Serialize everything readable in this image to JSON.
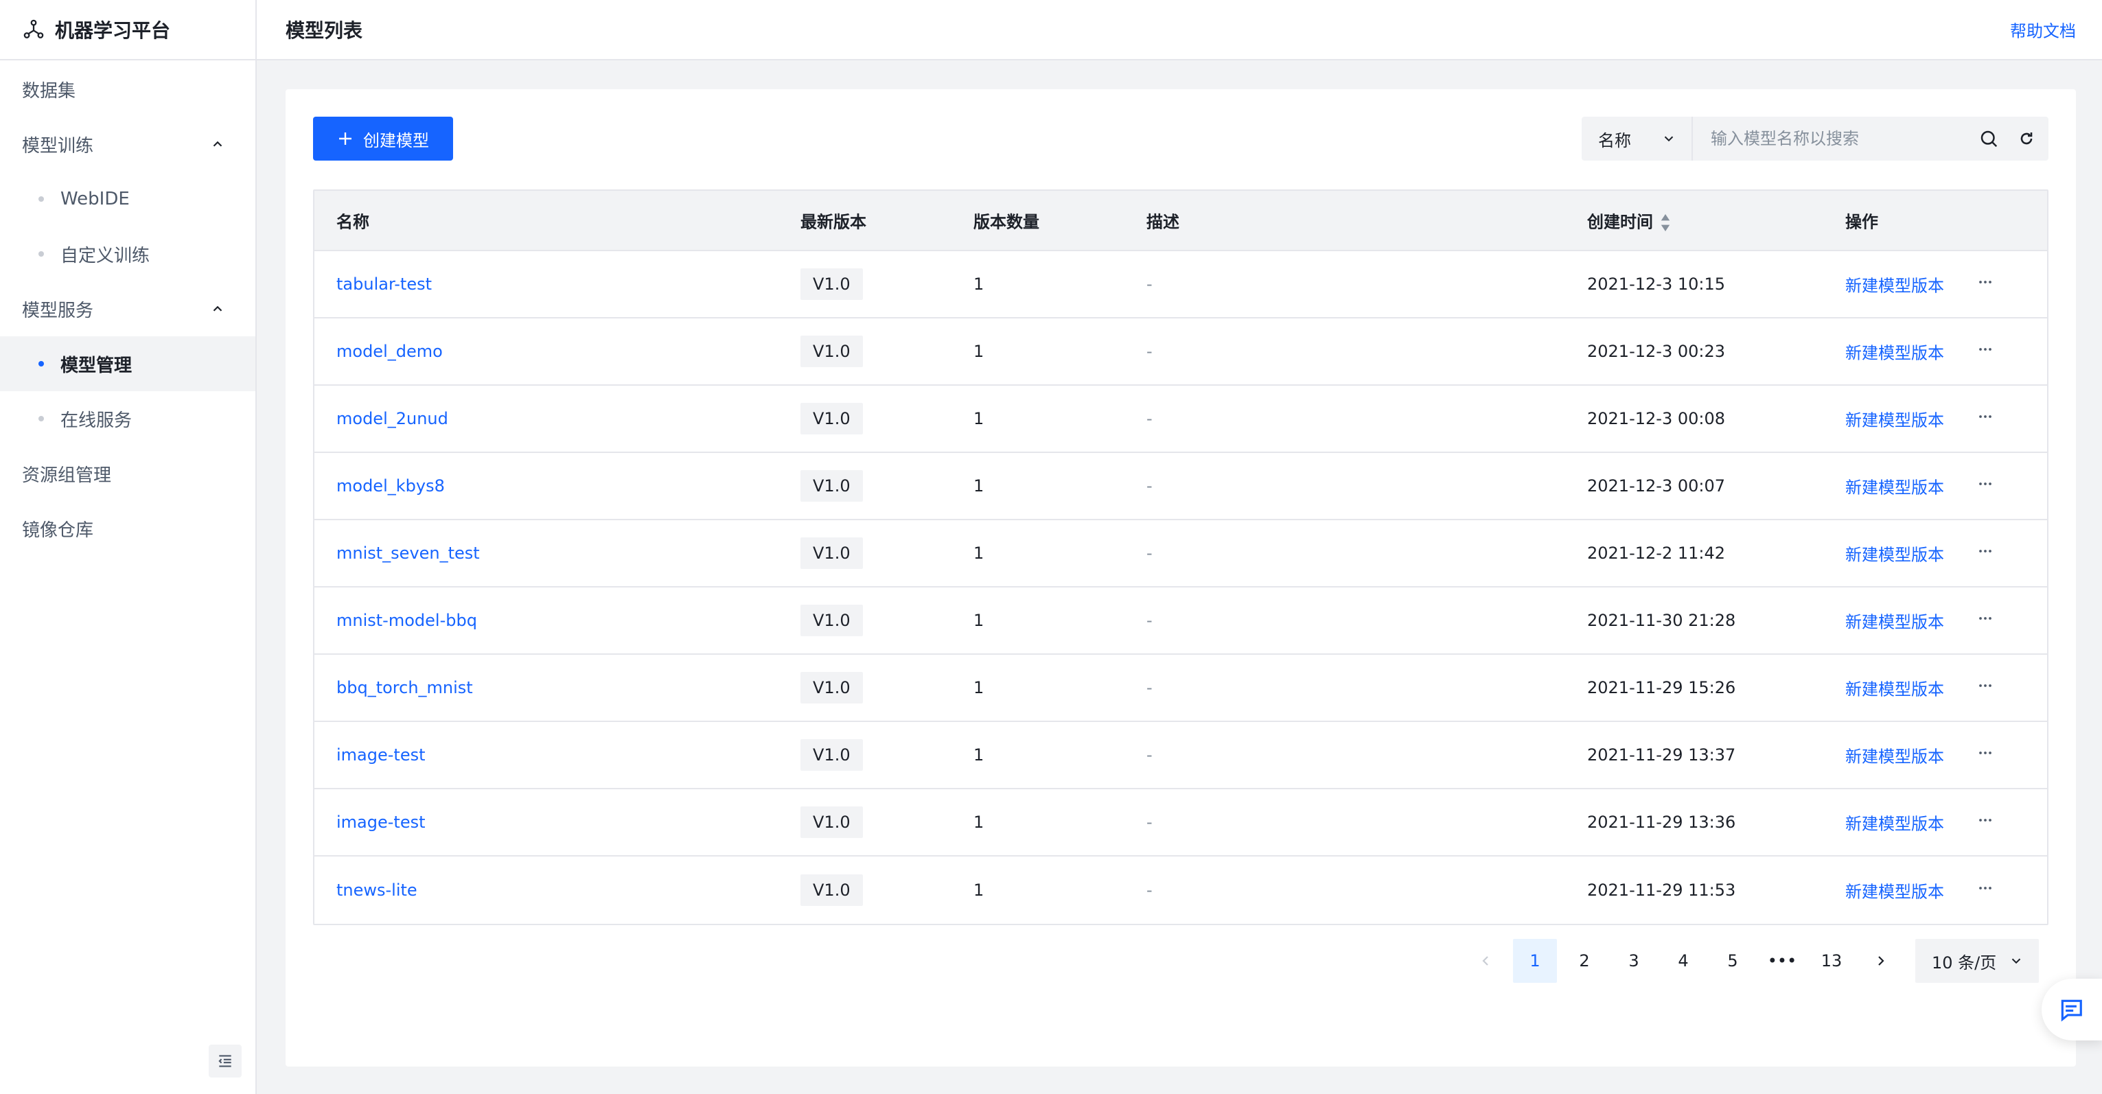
{
  "brand": {
    "title": "机器学习平台",
    "icon": "network-nodes-icon"
  },
  "header": {
    "title": "模型列表",
    "help": "帮助文档"
  },
  "sidebar": {
    "items": [
      {
        "label": "数据集"
      },
      {
        "label": "模型训练",
        "expanded": true
      },
      {
        "label": "WebIDE"
      },
      {
        "label": "自定义训练"
      },
      {
        "label": "模型服务",
        "expanded": true
      },
      {
        "label": "模型管理",
        "active": true
      },
      {
        "label": "在线服务"
      },
      {
        "label": "资源组管理"
      },
      {
        "label": "镜像仓库"
      }
    ]
  },
  "toolbar": {
    "create_label": "创建模型",
    "search_field": "名称",
    "search_placeholder": "输入模型名称以搜索"
  },
  "table": {
    "headers": {
      "name": "名称",
      "version": "最新版本",
      "count": "版本数量",
      "desc": "描述",
      "time": "创建时间",
      "op": "操作"
    },
    "rows": [
      {
        "name": "tabular-test",
        "version": "V1.0",
        "count": "1",
        "desc": "-",
        "time": "2021-12-3 10:15",
        "op": "新建模型版本"
      },
      {
        "name": "model_demo",
        "version": "V1.0",
        "count": "1",
        "desc": "-",
        "time": "2021-12-3 00:23",
        "op": "新建模型版本"
      },
      {
        "name": "model_2unud",
        "version": "V1.0",
        "count": "1",
        "desc": "-",
        "time": "2021-12-3 00:08",
        "op": "新建模型版本"
      },
      {
        "name": "model_kbys8",
        "version": "V1.0",
        "count": "1",
        "desc": "-",
        "time": "2021-12-3 00:07",
        "op": "新建模型版本"
      },
      {
        "name": "mnist_seven_test",
        "version": "V1.0",
        "count": "1",
        "desc": "-",
        "time": "2021-12-2 11:42",
        "op": "新建模型版本"
      },
      {
        "name": "mnist-model-bbq",
        "version": "V1.0",
        "count": "1",
        "desc": "-",
        "time": "2021-11-30 21:28",
        "op": "新建模型版本"
      },
      {
        "name": "bbq_torch_mnist",
        "version": "V1.0",
        "count": "1",
        "desc": "-",
        "time": "2021-11-29 15:26",
        "op": "新建模型版本"
      },
      {
        "name": "image-test",
        "version": "V1.0",
        "count": "1",
        "desc": "-",
        "time": "2021-11-29 13:37",
        "op": "新建模型版本"
      },
      {
        "name": "image-test",
        "version": "V1.0",
        "count": "1",
        "desc": "-",
        "time": "2021-11-29 13:36",
        "op": "新建模型版本"
      },
      {
        "name": "tnews-lite",
        "version": "V1.0",
        "count": "1",
        "desc": "-",
        "time": "2021-11-29 11:53",
        "op": "新建模型版本"
      }
    ]
  },
  "pagination": {
    "pages": [
      "1",
      "2",
      "3",
      "4",
      "5",
      "•••",
      "13"
    ],
    "current": "1",
    "page_size": "10 条/页"
  },
  "colors": {
    "accent": "#1664ff",
    "bg": "#f2f3f5"
  }
}
